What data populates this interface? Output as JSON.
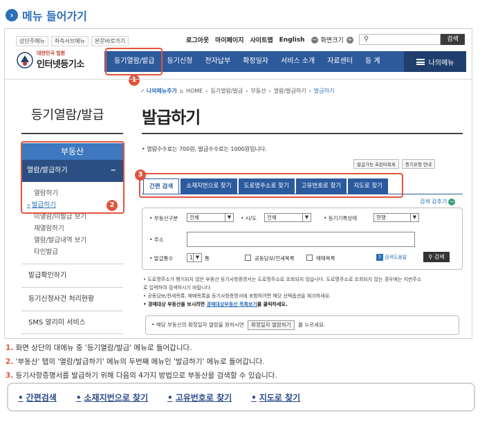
{
  "section_title": "메뉴 들어가기",
  "top_skip": [
    "상단주메뉴",
    "좌측서브메뉴",
    "본문바로가기"
  ],
  "top_util": {
    "login": "로그아웃",
    "mypage": "마이페이지",
    "sitemap": "사이트맵",
    "english": "English",
    "zoom_label": "화면크기",
    "search_btn": "검색"
  },
  "logo": {
    "line1": "대한민국 법원",
    "line2": "인터넷등기소"
  },
  "gnb": [
    "등기열람/발급",
    "등기신청",
    "전자납부",
    "확정일자",
    "서비스 소개",
    "자료센터",
    "등 계"
  ],
  "my_menu": "나의메뉴",
  "breadcrumb": {
    "my_add": "나의메뉴추가",
    "path": [
      "HOME",
      "등기열람/발급",
      "부동산",
      "열람/발급하기"
    ],
    "current": "발급하기"
  },
  "sidebar": {
    "title": "등기열람/발급",
    "head": "부동산",
    "sub": "열람/발급하기",
    "sub_toggle": "−",
    "sub_items": [
      "열람하기",
      "발급하기",
      "미열람/미발급 보기",
      "재열람하기",
      "열람/발급내역 보기",
      "타인발급"
    ],
    "menus": [
      "발급확인하기",
      "등기신청사건 처리현황",
      "SMS 알리미 서비스"
    ]
  },
  "main": {
    "title": "발급하기",
    "fee": "• 열람수수료는 700원, 발급수수료는 1000원입니다.",
    "links": [
      "발급가능 프린터목록",
      "증기유형 안내"
    ],
    "tabs": [
      "간편 검색",
      "소재지번으로 찾기",
      "도로명주소로 찾기",
      "고유번호로 찾기",
      "지도로 찾기"
    ],
    "more": "검색 감추기",
    "form": {
      "kind_label": "• 부동산구분",
      "kind_value": "전체",
      "city_label": "• 시/도",
      "city_value": "전체",
      "status_label": "• 등기기록상태",
      "status_value": "현행",
      "addr_label": "• 주소",
      "count_label": "• 발급통수",
      "count_value": "1",
      "count_unit": "통",
      "chk1": "공동담보/전세목록",
      "chk2": "매매목록",
      "help": "검색도움말",
      "go": "검색"
    },
    "notes": [
      "• 도로명주소가 병기되지 않은 부동산 등기사항증명서는 도로명주소로 조회되지 않습니다. 도로명주소로 조회되지 않는 경우에는 지번주소",
      "  로 입력하여 검색하시기 바랍니다.",
      "• 공동담보/전세목록, 매매목록을 등기사항증명서에 포함하려면 해당 선택옵션을 체크하세요."
    ],
    "note_link_pre": "• 경매대상 부동산을 보시려면 ",
    "note_link": "경매대상부동산 목록보기",
    "note_link_post": "를 클릭하세요.",
    "box_pre": "• 해당 부동산의 확정일자 열람을 원하시면",
    "box_btn": "확정일자 열람하기",
    "box_post": "를 누르세요."
  },
  "markers": [
    "1",
    "2",
    "3"
  ],
  "steps": [
    {
      "n": "1.",
      "text": "화면 상단의 대메뉴 중 '등기열람/발급' 메뉴로 들어갑니다."
    },
    {
      "n": "2.",
      "text": "'부동산' 탭의 '열람/발급하기' 메뉴의 두번째 메뉴인 '발급하기' 메뉴로 들어갑니다."
    },
    {
      "n": "3.",
      "text": "등기사항증명서를 발급하기 위해 다음의 4가지 방법으로 부동산을 검색할 수 있습니다."
    }
  ],
  "methods": [
    "간편검색",
    "소재지번으로 찾기",
    "고유번호로 찾기",
    "지도로 찾기"
  ],
  "colors": {
    "accent": "#2c6fb8",
    "nav": "#2d5a9b",
    "highlight": "#e0543c"
  }
}
